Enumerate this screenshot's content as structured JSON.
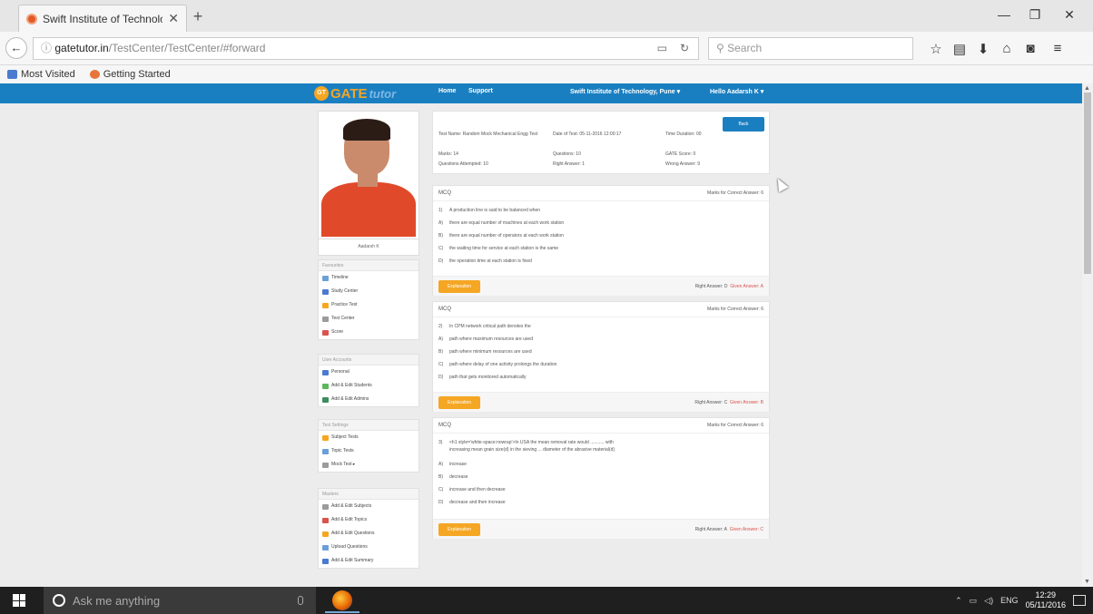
{
  "browser": {
    "tab_title": "Swift Institute of Technolo...",
    "url_host": "gatetutor.in",
    "url_path": "/TestCenter/TestCenter/#forward",
    "search_placeholder": "Search",
    "bookmarks": [
      "Most Visited",
      "Getting Started"
    ]
  },
  "site": {
    "logo_gate": "GATE",
    "logo_tutor": "tutor",
    "nav": [
      "Home",
      "Support"
    ],
    "institute": "Swift Institute of Technology, Pune ▾",
    "greeting": "Hello Aadarsh K ▾"
  },
  "sidebar": {
    "user_name": "Aadarsh K",
    "groups": [
      {
        "title": "Favourites",
        "items": [
          "Timeline",
          "Study Center",
          "Practice Test",
          "Test Center",
          "Score"
        ]
      },
      {
        "title": "User Accounts",
        "items": [
          "Personal",
          "Add & Edit Students",
          "Add & Edit Admins"
        ]
      },
      {
        "title": "Test Settings",
        "items": [
          "Subject Tests",
          "Topic Tests",
          "Mock Test ▸"
        ]
      },
      {
        "title": "Masters",
        "items": [
          "Add & Edit Subjects",
          "Add & Edit Topics",
          "Add & Edit Questions",
          "Upload Questions",
          "Add & Edit Summary"
        ]
      }
    ]
  },
  "summary": {
    "test_name": "Test Name: Random Mock Mechanical Engg Test",
    "date": "Date of Test: 05-11-2016 12:00:17",
    "duration": "Time Duration: 00",
    "marks": "Marks: 14",
    "questions": "Questions: 10",
    "gate_score": "GATE Score: 0",
    "attempted": "Questions Attempted: 10",
    "right": "Right Answer: 1",
    "wrong": "Wrong Answer: 9",
    "back_label": "Back"
  },
  "questions": [
    {
      "type": "MCQ",
      "marks": "Marks for Correct Answer: 6",
      "stem": "A production line is said to be balanced when",
      "options": [
        {
          "key": "A)",
          "text": "there are equal number of machines at each work station"
        },
        {
          "key": "B)",
          "text": "there are equal number of operators at each work station"
        },
        {
          "key": "C)",
          "text": "the waiting time for service at each station is the same"
        },
        {
          "key": "D)",
          "text": "the operation time at each station is fixed"
        }
      ],
      "explanation": "Explanation",
      "right_answer": "Right Answer: D",
      "given_answer": "Given Answer: A"
    },
    {
      "type": "MCQ",
      "marks": "Marks for Correct Answer: 6",
      "stem": "In CPM network critical path denotes the",
      "options": [
        {
          "key": "A)",
          "text": "path where maximum resources are used"
        },
        {
          "key": "B)",
          "text": "path where minimum resources are used"
        },
        {
          "key": "C)",
          "text": "path where delay of one activity prolongs the duration"
        },
        {
          "key": "D)",
          "text": "path that gets monitored automatically"
        }
      ],
      "explanation": "Explanation",
      "right_answer": "Right Answer: C",
      "given_answer": "Given Answer: B"
    },
    {
      "type": "MCQ",
      "marks": "Marks for Correct Answer: 6",
      "stem": "<h1 style='white-space:nowrap'>In USA the mean removal rate would ........... with",
      "stem2": "increasing mean grain size(d) in the sieving ... diameter of the abrasive material(d)",
      "options": [
        {
          "key": "A)",
          "text": "increase"
        },
        {
          "key": "B)",
          "text": "decrease"
        },
        {
          "key": "C)",
          "text": "increase and then decrease"
        },
        {
          "key": "D)",
          "text": "decrease and then increase"
        }
      ],
      "explanation": "Explanation",
      "right_answer": "Right Answer: A",
      "given_answer": "Given Answer: C"
    }
  ],
  "taskbar": {
    "search_placeholder": "Ask me anything",
    "lang": "ENG",
    "time": "12:29",
    "date": "05/11/2016"
  }
}
